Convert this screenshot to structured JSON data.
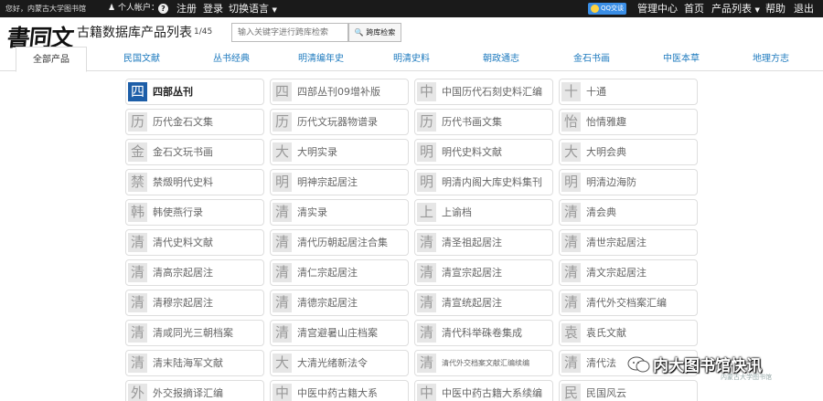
{
  "topbar": {
    "greeting": "您好，内蒙古大学图书馆",
    "account": "个人帐户：",
    "help_badge": "?",
    "register": "注册",
    "login": "登录",
    "language": "切换语言",
    "qq": "QQ交谈",
    "admin": "管理中心",
    "home": "首页",
    "product_list": "产品列表",
    "help": "帮助",
    "logout": "退出"
  },
  "header": {
    "logo": "書同文",
    "title": "古籍数据库产品列表",
    "page_count": "1/45",
    "search_placeholder": "输入关键字进行跨库检索",
    "search_button": "跨库检索"
  },
  "tabs": [
    "全部产品",
    "民国文献",
    "丛书经典",
    "明清编年史",
    "明清史料",
    "朝政通志",
    "金石书画",
    "中医本草",
    "地理方志"
  ],
  "products": [
    [
      "四",
      "四部丛刊"
    ],
    [
      "四",
      "四部丛刊09增补版"
    ],
    [
      "中",
      "中国历代石刻史料汇编"
    ],
    [
      "十",
      "十通"
    ],
    [
      "历",
      "历代金石文集"
    ],
    [
      "历",
      "历代文玩器物谱录"
    ],
    [
      "历",
      "历代书画文集"
    ],
    [
      "怡",
      "怡情雅趣"
    ],
    [
      "金",
      "金石文玩书画"
    ],
    [
      "大",
      "大明实录"
    ],
    [
      "明",
      "明代史料文献"
    ],
    [
      "大",
      "大明会典"
    ],
    [
      "禁",
      "禁燬明代史料"
    ],
    [
      "明",
      "明神宗起居注"
    ],
    [
      "明",
      "明清内阁大库史料集刊"
    ],
    [
      "明",
      "明清边海防"
    ],
    [
      "韩",
      "韩使燕行录"
    ],
    [
      "清",
      "清实录"
    ],
    [
      "上",
      "上谕档"
    ],
    [
      "清",
      "清会典"
    ],
    [
      "清",
      "清代史料文献"
    ],
    [
      "清",
      "清代历朝起居注合集"
    ],
    [
      "清",
      "清圣祖起居注"
    ],
    [
      "清",
      "清世宗起居注"
    ],
    [
      "清",
      "清高宗起居注"
    ],
    [
      "清",
      "清仁宗起居注"
    ],
    [
      "清",
      "清宣宗起居注"
    ],
    [
      "清",
      "清文宗起居注"
    ],
    [
      "清",
      "清穆宗起居注"
    ],
    [
      "清",
      "清德宗起居注"
    ],
    [
      "清",
      "清宣统起居注"
    ],
    [
      "清",
      "清代外交档案汇编"
    ],
    [
      "清",
      "清咸同光三朝档案"
    ],
    [
      "清",
      "清宫避暑山庄档案"
    ],
    [
      "清",
      "清代科举硃卷集成"
    ],
    [
      "袁",
      "袁氏文献"
    ],
    [
      "清",
      "清末陆海军文献"
    ],
    [
      "大",
      "大清光绪新法令"
    ],
    [
      "清",
      "清代外交档案文献汇编续编"
    ],
    [
      "清",
      "清代法"
    ],
    [
      "外",
      "外交报摘译汇编"
    ],
    [
      "中",
      "中医中药古籍大系"
    ],
    [
      "中",
      "中医中药古籍大系续编"
    ],
    [
      "民",
      "民国风云"
    ]
  ],
  "watermark": {
    "text": "内大图书馆快讯",
    "sub": "内蒙古大学图书馆"
  },
  "colors": {
    "topbar": "#1a1a1a",
    "link_blue": "#1f7bbf",
    "active_glyph": "#1d5ea8",
    "glyph_bg": "#e6e6e6"
  }
}
